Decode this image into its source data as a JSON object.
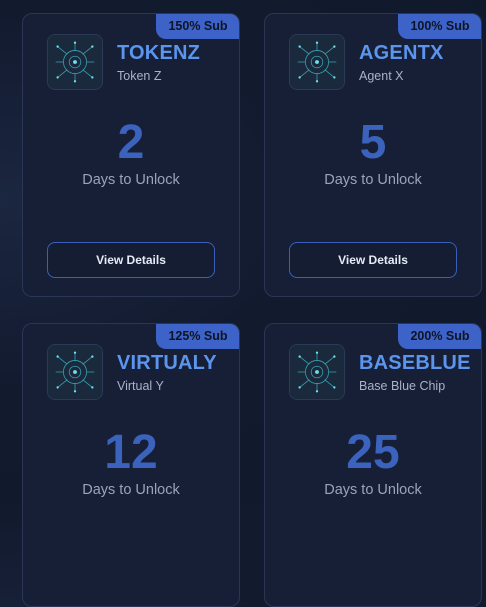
{
  "cards": [
    {
      "badge": "150% Sub",
      "symbol": "TOKENZ",
      "name": "Token Z",
      "days": "2",
      "days_label": "Days to Unlock",
      "button": "View Details"
    },
    {
      "badge": "100% Sub",
      "symbol": "AGENTX",
      "name": "Agent X",
      "days": "5",
      "days_label": "Days to Unlock",
      "button": "View Details"
    },
    {
      "badge": "125% Sub",
      "symbol": "VIRTUALY",
      "name": "Virtual Y",
      "days": "12",
      "days_label": "Days to Unlock"
    },
    {
      "badge": "200% Sub",
      "symbol": "BASEBLUE",
      "name": "Base Blue Chip",
      "days": "25",
      "days_label": "Days to Unlock"
    }
  ],
  "colors": {
    "accent": "#3e63c8",
    "symbol": "#5b95ee",
    "days": "#3b62bd",
    "card_bg": "#161f36"
  },
  "icons": {
    "token_logo": "circuit-brain-icon"
  }
}
